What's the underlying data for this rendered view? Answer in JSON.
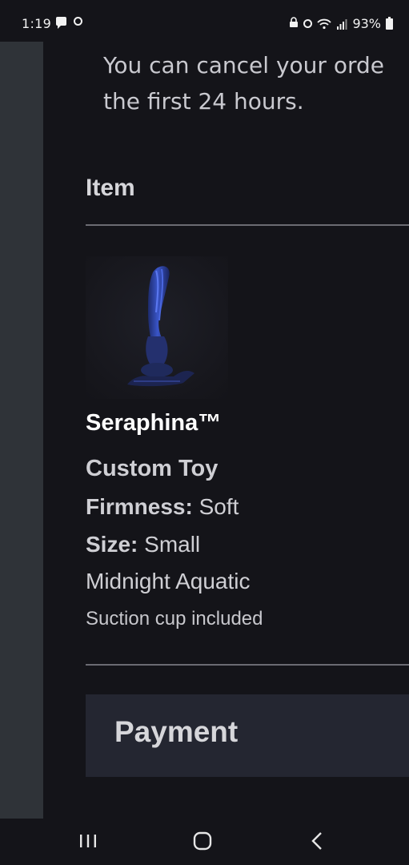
{
  "status_bar": {
    "time": "1:19",
    "battery": "93%",
    "icons_left": [
      "chat-icon",
      "alarm-icon"
    ],
    "icons_right": [
      "lock-icon",
      "alarm-icon",
      "wifi-icon",
      "signal-icon",
      "battery-icon"
    ]
  },
  "order": {
    "notice_line1": "You can cancel your orde",
    "notice_line2": "the first 24 hours.",
    "item_section_title": "Item",
    "product": {
      "name": "Seraphina™",
      "type": "Custom Toy",
      "firmness_label": "Firmness:",
      "firmness_value": " Soft",
      "size_label": "Size:",
      "size_value": " Small",
      "color": "Midnight Aquatic",
      "accessory": "Suction cup included",
      "image_colors": {
        "body": "#2a3c8f",
        "highlight": "#4a6ae0",
        "base": "#1c2450"
      }
    },
    "payment_title": "Payment"
  },
  "nav_bar": {
    "buttons": [
      "recent-apps-icon",
      "home-icon",
      "back-icon"
    ]
  }
}
